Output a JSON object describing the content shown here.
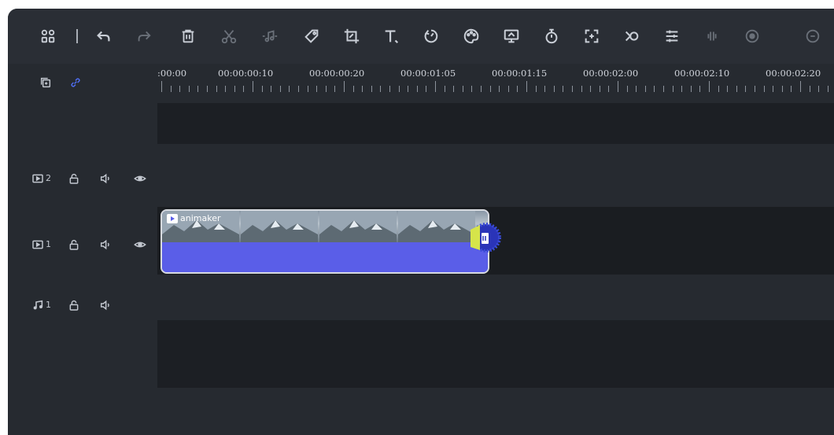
{
  "toolbar": {
    "buttons": [
      {
        "name": "layout-grid-icon"
      },
      {
        "name": "undo-icon"
      },
      {
        "name": "redo-icon"
      },
      {
        "name": "delete-icon"
      },
      {
        "name": "cut-icon"
      },
      {
        "name": "audio-detach-icon"
      },
      {
        "name": "tag-icon"
      },
      {
        "name": "crop-icon"
      },
      {
        "name": "text-icon"
      },
      {
        "name": "speed-icon"
      },
      {
        "name": "color-icon"
      },
      {
        "name": "green-screen-icon"
      },
      {
        "name": "timer-icon"
      },
      {
        "name": "fit-frame-icon"
      },
      {
        "name": "transition-icon"
      },
      {
        "name": "adjust-icon"
      },
      {
        "name": "audio-split-icon"
      },
      {
        "name": "record-icon"
      },
      {
        "name": "more-icon"
      }
    ]
  },
  "ruler": {
    "labels": [
      ":00:00",
      "00:00:00:10",
      "00:00:00:20",
      "00:00:01:05",
      "00:00:01:15",
      "00:00:02:00",
      "00:00:02:10",
      "00:00:02:20"
    ]
  },
  "tracks": [
    {
      "type": "video",
      "number": "2"
    },
    {
      "type": "video",
      "number": "1"
    },
    {
      "type": "audio",
      "number": "1"
    }
  ],
  "clip": {
    "label": "animaker"
  },
  "colors": {
    "background": "#1f2329",
    "panel": "#262a30",
    "clip_audio": "#5a5ee8",
    "handle_ring": "#3a4bd6",
    "handle_accent": "#d6e44a"
  }
}
